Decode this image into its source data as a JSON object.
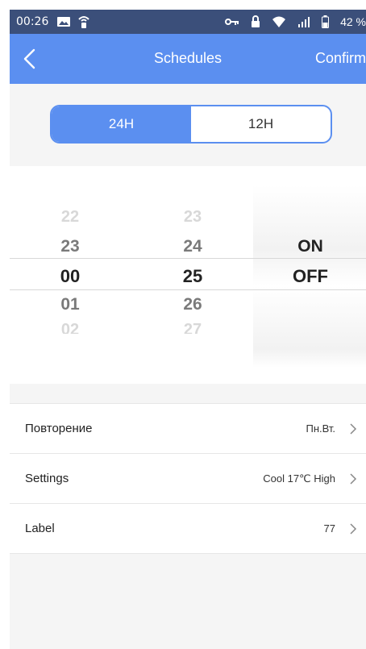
{
  "status_bar": {
    "time": "00:26",
    "battery_text": "42 %",
    "icons": [
      "image-icon",
      "remote-signal-icon",
      "key-icon",
      "lock-icon",
      "wifi-icon",
      "cellular-icon",
      "battery-icon"
    ]
  },
  "nav": {
    "back_icon": "chevron-left-icon",
    "title": "Schedules",
    "confirm": "Confirm"
  },
  "format_toggle": {
    "options": [
      "24H",
      "12H"
    ],
    "selected": "24H",
    "accent": "#5b8ff0"
  },
  "picker": {
    "hours": [
      "22",
      "23",
      "00",
      "01",
      "02"
    ],
    "minutes": [
      "23",
      "24",
      "25",
      "26",
      "27"
    ],
    "state": [
      "ON",
      "OFF"
    ],
    "selected_hour": "00",
    "selected_minute": "25",
    "selected_state": "OFF"
  },
  "settings": [
    {
      "label": "Повторение",
      "value": "Пн.Вт."
    },
    {
      "label": "Settings",
      "value": "Cool 17℃ High"
    },
    {
      "label": "Label",
      "value": "77"
    }
  ]
}
